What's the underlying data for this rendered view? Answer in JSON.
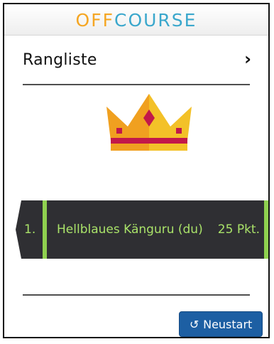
{
  "header": {
    "logo_text": "OFFCOURSE",
    "logo_parts": {
      "off": "OFF",
      "course": "COURSE"
    },
    "colors": {
      "off": "#f5a623",
      "course": "#3aa7cc"
    }
  },
  "page": {
    "title": "Rangliste",
    "chevron_icon": "chevron-right-icon"
  },
  "crown_icon": "crown-icon",
  "leaderboard": [
    {
      "rank": "1.",
      "name": "Hellblaues Känguru (du)",
      "points": "25 Pkt."
    }
  ],
  "actions": {
    "restart_label": "Neustart",
    "restart_icon": "restart-icon"
  },
  "colors": {
    "banner": "#2f2f33",
    "accent_green": "#8fd14f",
    "button_blue": "#1d5fa3"
  }
}
